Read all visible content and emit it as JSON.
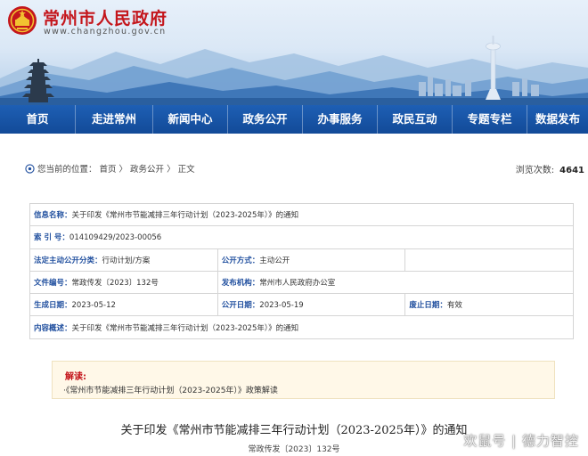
{
  "header": {
    "site_title": "常州市人民政府",
    "site_url": "www.changzhou.gov.cn"
  },
  "nav": {
    "items": [
      "首页",
      "走进常州",
      "新闻中心",
      "政务公开",
      "办事服务",
      "政民互动",
      "专题专栏",
      "数据发布"
    ]
  },
  "location": {
    "prefix": "您当前的位置：",
    "crumbs": [
      "首页",
      "政务公开",
      "正文"
    ],
    "sep": " 〉",
    "views_label": "浏览次数:",
    "views_count": "4641"
  },
  "info": {
    "r1_label": "信息名称：",
    "r1_value": "关于印发《常州市节能减排三年行动计划（2023-2025年）》的通知",
    "r2_label": "索  引  号：",
    "r2_value": "014109429/2023-00056",
    "r3_label_a": "法定主动公开分类：",
    "r3_value_a": "行动计划/方案",
    "r3_label_b": "公开方式：",
    "r3_value_b": "主动公开",
    "r4_label_a": "文件编号：",
    "r4_value_a": "常政传发〔2023〕132号",
    "r4_label_b": "发布机构：",
    "r4_value_b": "常州市人民政府办公室",
    "r5_label_a": "生成日期：",
    "r5_value_a": "2023-05-12",
    "r5_label_b": "公开日期：",
    "r5_value_b": "2023-05-19",
    "r5_label_c": "废止日期：",
    "r5_value_c": "有效",
    "r6_label": "内容概述：",
    "r6_value": "关于印发《常州市节能减排三年行动计划（2023-2025年）》的通知"
  },
  "reading": {
    "title": "解读:",
    "link": "·《常州市节能减排三年行动计划（2023-2025年）》政策解读"
  },
  "article": {
    "title": "关于印发《常州市节能减排三年行动计划（2023-2025年）》的通知",
    "doc_no": "常政传发〔2023〕132号"
  },
  "watermark": "欢鼠号 | 德力智控",
  "colors": {
    "brand_red": "#c4161c",
    "nav_blue": "#124a98",
    "label_blue": "#1f4e9e"
  }
}
